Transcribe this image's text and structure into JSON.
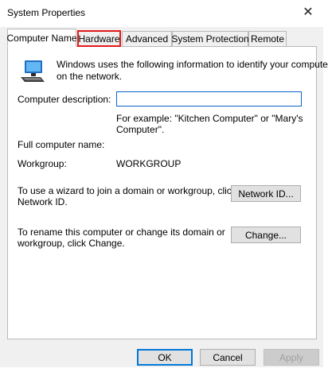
{
  "window": {
    "title": "System Properties",
    "close_glyph": "✕"
  },
  "tabs": [
    {
      "label": "Computer Name",
      "selected": true
    },
    {
      "label": "Hardware",
      "selected": false,
      "highlighted": true
    },
    {
      "label": "Advanced",
      "selected": false
    },
    {
      "label": "System Protection",
      "selected": false
    },
    {
      "label": "Remote",
      "selected": false
    }
  ],
  "panel": {
    "icon": "computer-icon",
    "intro_line1": "Windows uses the following information to identify your computer",
    "intro_line2": "on the network.",
    "description_label": "Computer description:",
    "description_value": "",
    "example_line1": "For example: \"Kitchen Computer\" or \"Mary's",
    "example_line2": "Computer\".",
    "full_name_label": "Full computer name:",
    "full_name_value": "",
    "workgroup_label": "Workgroup:",
    "workgroup_value": "WORKGROUP",
    "wizard_line1": "To use a wizard to join a domain or workgroup, click",
    "wizard_line2": "Network ID.",
    "network_id_button": "Network ID...",
    "rename_line1": "To rename this computer or change its domain or",
    "rename_line2": "workgroup, click Change.",
    "change_button": "Change..."
  },
  "footer": {
    "ok": "OK",
    "cancel": "Cancel",
    "apply": "Apply"
  },
  "colors": {
    "highlight": "#e21a1a",
    "focus": "#0078d7"
  }
}
